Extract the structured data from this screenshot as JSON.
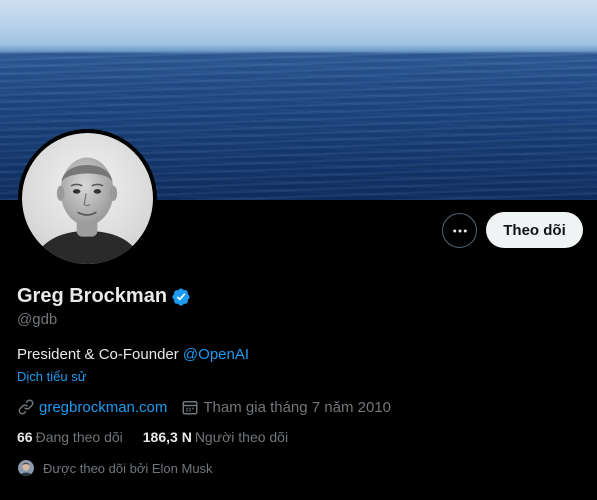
{
  "profile": {
    "name": "Greg Brockman",
    "handle": "@gdb",
    "bio_text": "President & Co-Founder ",
    "bio_mention": "@OpenAI",
    "translate_label": "Dịch tiểu sử",
    "website": "gregbrockman.com",
    "joined": "Tham gia tháng 7 năm 2010"
  },
  "actions": {
    "follow_label": "Theo dõi"
  },
  "stats": {
    "following_count": "66",
    "following_label": "Đang theo dõi",
    "followers_count": "186,3 N",
    "followers_label": "Người theo dõi"
  },
  "followed_by": "Được theo dõi bởi Elon Musk",
  "colors": {
    "background": "#000000",
    "accent": "#1d9bf0",
    "follow_button_bg": "#eff3f4",
    "secondary_text": "#71767b"
  },
  "icons": [
    "more-icon",
    "verified-badge-icon",
    "link-icon",
    "calendar-icon"
  ]
}
